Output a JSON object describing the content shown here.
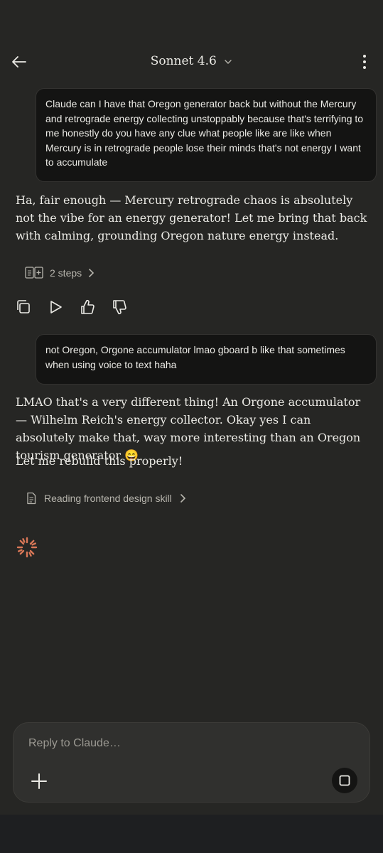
{
  "header": {
    "model_label": "Sonnet 4.6"
  },
  "messages": {
    "user_1": "Claude can I have that Oregon generator back but without the Mercury and retrograde energy collecting unstoppably because that's terrifying to me honestly do you have any clue what people like are like when Mercury is in retrograde people lose their minds that's not energy I want to accumulate",
    "assistant_1": "Ha, fair enough — Mercury retrograde chaos is absolutely not the vibe for an energy generator! Let me bring that back with calming, grounding Oregon nature energy instead.",
    "steps_label": "2 steps",
    "user_2": "not Oregon,  Orgone accumulator lmao gboard b like that sometimes when using voice to text haha",
    "assistant_2": "LMAO that's a very different thing! An Orgone accumulator — Wilhelm Reich's energy collector. Okay yes I can absolutely make that, way more interesting than an Oregon tourism generator 😄",
    "assistant_3": "Let me rebuild this properly!",
    "reading_label": "Reading frontend design skill"
  },
  "composer": {
    "placeholder": "Reply to Claude…"
  },
  "colors": {
    "background": "#262624",
    "accent_spinner": "#D97757",
    "user_bubble": "#141413"
  },
  "icons": [
    "back-arrow-icon",
    "chevron-down-icon",
    "more-vertical-icon",
    "document-icon",
    "chevron-right-icon",
    "copy-icon",
    "play-icon",
    "thumbs-up-icon",
    "thumbs-down-icon",
    "spinner-icon",
    "plus-icon",
    "stop-icon"
  ]
}
